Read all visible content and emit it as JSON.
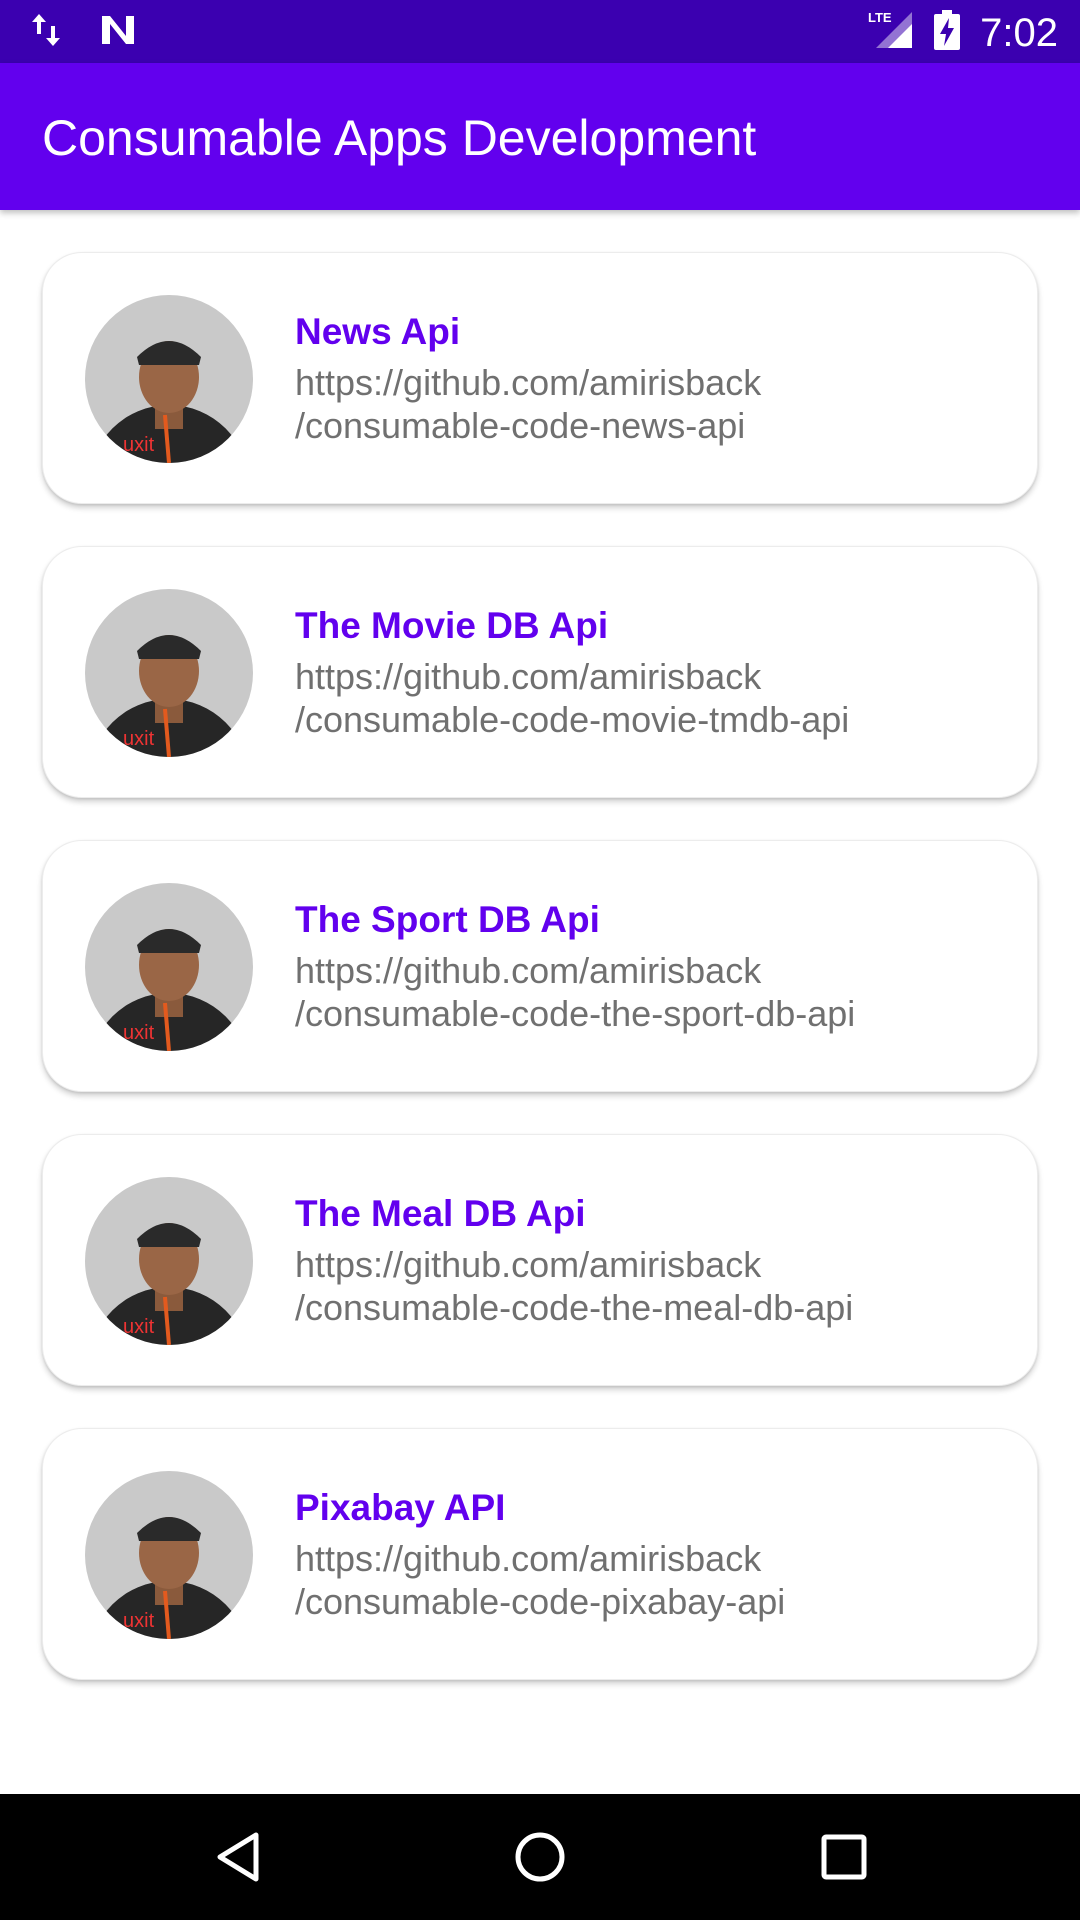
{
  "status_bar": {
    "time": "7:02",
    "icons": [
      "data-transfer-icon",
      "n-notification-icon",
      "lte-signal-icon",
      "battery-charging-icon"
    ]
  },
  "app_bar": {
    "title": "Consumable Apps Development",
    "color": "#6200ee"
  },
  "repos": [
    {
      "title": "News Api",
      "url_line1": "https://github.com/amirisback",
      "url_line2": "/consumable-code-news-api"
    },
    {
      "title": "The Movie DB Api",
      "url_line1": "https://github.com/amirisback",
      "url_line2": "/consumable-code-movie-tmdb-api"
    },
    {
      "title": "The Sport DB Api",
      "url_line1": "https://github.com/amirisback",
      "url_line2": "/consumable-code-the-sport-db-api"
    },
    {
      "title": "The Meal DB Api",
      "url_line1": "https://github.com/amirisback",
      "url_line2": "/consumable-code-the-meal-db-api"
    },
    {
      "title": "Pixabay API",
      "url_line1": "https://github.com/amirisback",
      "url_line2": "/consumable-code-pixabay-api"
    }
  ],
  "nav_bar": {
    "buttons": [
      "back-icon",
      "home-icon",
      "recents-icon"
    ]
  }
}
